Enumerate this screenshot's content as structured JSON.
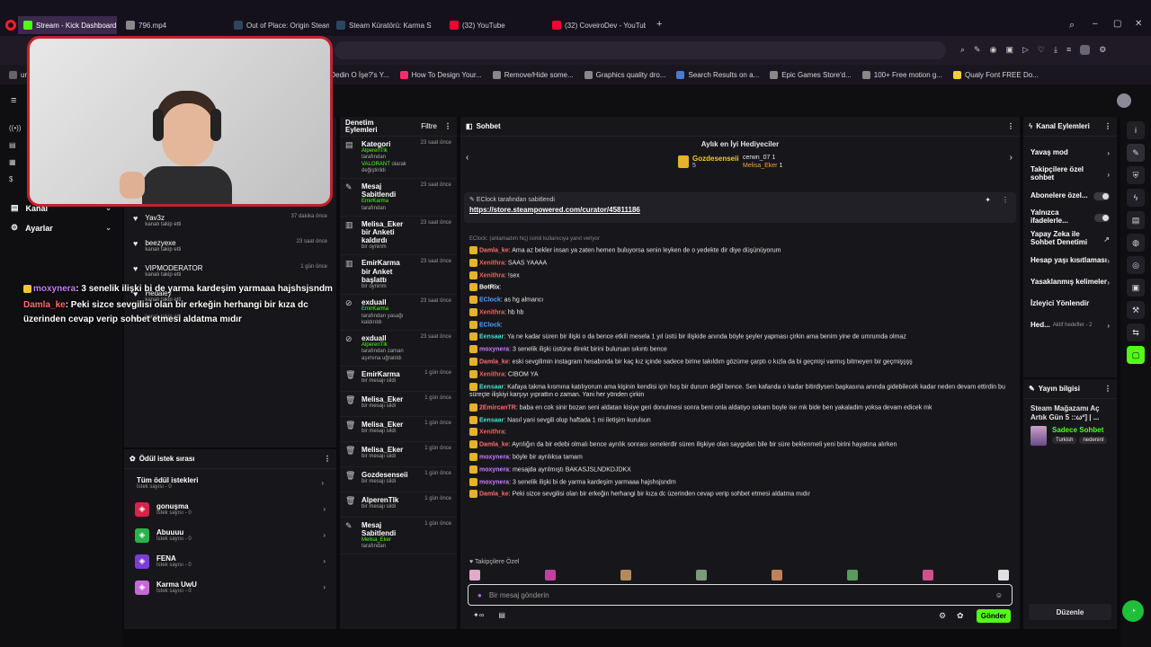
{
  "browser": {
    "tabs": [
      {
        "title": "Stream - Kick Dashboard",
        "color": "#53fc18",
        "active": true
      },
      {
        "title": "796.mp4",
        "color": "#888888"
      },
      {
        "title": "Out of Place: Origin Steam",
        "color": "#2a475e"
      },
      {
        "title": "Steam Küratörü: Karma St",
        "color": "#2a475e"
      },
      {
        "title": "(32) YouTube",
        "color": "#ff0033"
      },
      {
        "title": "(32) CoveiroDev - YouTub",
        "color": "#ff0033"
      }
    ],
    "new_tab": "+",
    "bookmarks": [
      {
        "label": "un",
        "color": "#666666"
      },
      {
        "label": "Ne Dedin O İşe?'s Y...",
        "color": "#777777"
      },
      {
        "label": "How To Design Your...",
        "color": "#ff2b6e"
      },
      {
        "label": "Remove/Hide some...",
        "color": "#888888"
      },
      {
        "label": "Graphics quality dro...",
        "color": "#888888"
      },
      {
        "label": "Search Results on a...",
        "color": "#4a7bd1"
      },
      {
        "label": "Epic Games Store'd...",
        "color": "#888888"
      },
      {
        "label": "100+ Free motion g...",
        "color": "#888888"
      },
      {
        "label": "Qualy Font FREE Do...",
        "color": "#f2d02f"
      }
    ]
  },
  "sidebar": {
    "items": [
      {
        "label": "Kanal"
      },
      {
        "label": "Ayarlar"
      }
    ]
  },
  "followers": [
    {
      "name": "Yav3z",
      "sub": "kanalı takip etti",
      "time": "37 dakika önce"
    },
    {
      "name": "beezyexe",
      "sub": "kanalı takip etti",
      "time": "23 saat önce"
    },
    {
      "name": "VIPMODERATOR",
      "sub": "kanalı takip etti",
      "time": "1 gün önce"
    },
    {
      "name": "Hedaley",
      "sub": "kanalı takip etti",
      "time": ""
    },
    {
      "name": "",
      "sub": "kanalı takip etti",
      "time": ""
    }
  ],
  "overlay": [
    {
      "user": "moxynera",
      "text": ": 3 senelik ilişki bi de yarma kardeşim yarmaaa hajshsjsndm",
      "ucolor": "#c87cff"
    },
    {
      "user": "Damla_ke",
      "text": ": Peki sizce sevgilisi olan bir erkeğin herhangi bir kıza dc",
      "ucolor": "#ff6b6b"
    },
    {
      "user": "",
      "text": "üzerinden cevap verip sohbet etmesi aldatma mıdır",
      "ucolor": "#ffffff"
    }
  ],
  "rewards": {
    "title": "Ödül istek sırası",
    "all": "Tüm ödül istekleri",
    "all_count": "İstek sayısı - 0",
    "items": [
      {
        "name": "gonuşma",
        "count": "İstek sayısı - 0",
        "color": "#d6244a"
      },
      {
        "name": "Abuuuu",
        "count": "İstek sayısı - 0",
        "color": "#2bb24c"
      },
      {
        "name": "FENA",
        "count": "İstek sayısı - 0",
        "color": "#7a3fd1"
      },
      {
        "name": "Karma UwU",
        "count": "İstek sayısı - 0",
        "color": "#c46ad8"
      }
    ]
  },
  "mod": {
    "title": "Denetim Eylemleri",
    "filter": "Filtre",
    "actions": [
      {
        "icon": "▤",
        "title": "Kategori",
        "line1": "AlperenTlk",
        "line1b": " tarafından",
        "line2": "VALORANT",
        "line2b": " olarak değiştirildi",
        "time": "23 saat önce"
      },
      {
        "icon": "✎",
        "title": "Mesaj Sabitlendi",
        "line1": "EmirKarma",
        "line1b": " tarafından",
        "line2": "",
        "line2b": "",
        "time": "23 saat önce"
      },
      {
        "icon": "▥",
        "title": "Melisa_Eker bir Anketi kaldırdı",
        "line1": "",
        "line1b": "bir oyninm",
        "line2": "",
        "line2b": "",
        "time": "23 saat önce"
      },
      {
        "icon": "▥",
        "title": "EmirKarma bir Anket başlattı",
        "line1": "",
        "line1b": "bir oyninm",
        "line2": "",
        "line2b": "",
        "time": "23 saat önce"
      },
      {
        "icon": "⊘",
        "title": "exduall",
        "line1": "EmirKarma",
        "line1b": " tarafından yasağı kaldırıldı",
        "line2": "",
        "line2b": "",
        "time": "23 saat önce"
      },
      {
        "icon": "⊘",
        "title": "exduall",
        "line1": "AlperenTlk",
        "line1b": " tarafından zaman aşımına uğratıldı",
        "line2": "",
        "line2b": "",
        "time": "23 saat önce"
      },
      {
        "icon": "🗑",
        "title": "EmirKarma",
        "line1": "",
        "line1b": "bir mesajı sildi",
        "line2": "",
        "line2b": "",
        "time": "1 gün önce"
      },
      {
        "icon": "🗑",
        "title": "Melisa_Eker",
        "line1": "",
        "line1b": "bir mesajı sildi",
        "line2": "",
        "line2b": "",
        "time": "1 gün önce"
      },
      {
        "icon": "🗑",
        "title": "Melisa_Eker",
        "line1": "",
        "line1b": "bir mesajı sildi",
        "line2": "",
        "line2b": "",
        "time": "1 gün önce"
      },
      {
        "icon": "🗑",
        "title": "Melisa_Eker",
        "line1": "",
        "line1b": "bir mesajı sildi",
        "line2": "",
        "line2b": "",
        "time": "1 gün önce"
      },
      {
        "icon": "🗑",
        "title": "Gozdesenseii",
        "line1": "",
        "line1b": "bir mesajı sildi",
        "line2": "",
        "line2b": "",
        "time": "1 gün önce"
      },
      {
        "icon": "🗑",
        "title": "AlperenTlk",
        "line1": "",
        "line1b": "bir mesajı sildi",
        "line2": "",
        "line2b": "",
        "time": "1 gün önce"
      },
      {
        "icon": "✎",
        "title": "Mesaj Sabitlendi",
        "line1": "Melisa_Eker",
        "line1b": " tarafından",
        "line2": "",
        "line2b": "",
        "time": "1 gün önce"
      }
    ]
  },
  "chat": {
    "title": "Sohbet",
    "gifters_title": "Aylık en İyi Hediyeciler",
    "gifters": [
      {
        "name": "Gozdesenseii",
        "count": "5"
      },
      {
        "name": "cerwn_07",
        "count": "1"
      },
      {
        "name": "Melisa_Eker",
        "count": "1"
      }
    ],
    "pinned_by": "EClock tarafından sabitlendi",
    "pinned_link": "https://store.steampowered.com/curator/45811186",
    "reply_hint": "EClock: (anlamadım hiç) isimli kullanıcıya yanıt veriyor",
    "messages": [
      {
        "user": "Damla_ke",
        "text": ": Ama az bekler insan ya zaten hemen buluyorsa senin leyken de o yedekte dir diye düşünüyorum",
        "color": "#ff6b6b"
      },
      {
        "user": "Xenithra",
        "text": ": SAAS YAAAA",
        "color": "#ff5a5a"
      },
      {
        "user": "Xenithra",
        "text": ": !sex",
        "color": "#ff5a5a"
      },
      {
        "user": "BotRix",
        "text": ":",
        "color": "#ffffff"
      },
      {
        "user": "EClock",
        "text": ": as hg almancı",
        "color": "#4aa3ff"
      },
      {
        "user": "Xenithra",
        "text": ": hb hb",
        "color": "#ff5a5a"
      },
      {
        "user": "EClock",
        "text": ":",
        "color": "#4aa3ff"
      },
      {
        "user": "Eensaar",
        "text": ": Ya ne kadar süren bir ilişki o da bence etkili mesela 1 yıl üstü bir ilişkide anında böyle şeyler yapması çirkin ama benim yine de umrumda olmaz",
        "color": "#4ee0d0"
      },
      {
        "user": "moxynera",
        "text": ": 3 senelik ilişki üstüne direkt birini bulursan sıkıntı bence",
        "color": "#c87cff"
      },
      {
        "user": "Damla_ke",
        "text": ": eski sevgilimin instagram hesabında bir kaç kız içinde sadece birine takıldım gözüme çarptı o kızla da bi geçmişi varmış bitmeyen bir geçmişşşş",
        "color": "#ff6b6b"
      },
      {
        "user": "Xenithra",
        "text": ": CIBOM YA",
        "color": "#ff5a5a"
      },
      {
        "user": "Eensaar",
        "text": ": Kafaya takma kısmına katılıyorum ama kişinin kendisi için hoş bir durum değil bence. Sen kafanda o kadar bitirdiysen başkasına anında gidebilecek kadar neden devam ettirdin bu süreçte ilişkiyi karşıyı yıprattın o zaman. Yani her yönden çirkin",
        "color": "#4ee0d0"
      },
      {
        "user": "2EmircanTR",
        "text": ": baba en cok sinir bozan seni aldatan kisiye geri donulmesi sonra beni onla aldatiyo sokam boyle ise mk bide ben yakaladim yoksa devam edicek mk",
        "color": "#ff6b6b"
      },
      {
        "user": "Eensaar",
        "text": ": Nasıl yani sevgili olup haftada 1 mi iletişim kurulsun",
        "color": "#4ee0d0"
      },
      {
        "user": "Xenithra",
        "text": ":",
        "color": "#ff5a5a"
      },
      {
        "user": "Damla_ke",
        "text": ": Ayrılığın da bir edebi olmalı bence ayrılık sonrası senelerdir süren ilişkiye olan saygıdan bile bir süre beklenmeli yeni birini hayatına alırken",
        "color": "#ff6b6b"
      },
      {
        "user": "moxynera",
        "text": ": böyle bir ayrılıksa tamam",
        "color": "#c87cff"
      },
      {
        "user": "moxynera",
        "text": ": mesajda ayrılmıştı BAKASJSLNDKDJDKX",
        "color": "#c87cff"
      },
      {
        "user": "moxynera",
        "text": ": 3 senelik ilişki bi de yarma kardeşim yarmaaa hajshsjsndm",
        "color": "#c87cff"
      },
      {
        "user": "Damla_ke",
        "text": ": Peki sizce sevgilisi olan bir erkeğin herhangi bir kıza dc üzerinden cevap verip sohbet etmesi aldatma mıdır",
        "color": "#ff6b6b"
      }
    ],
    "followers_only": "Takipçilere Özel",
    "input_placeholder": "Bir mesaj gönderin",
    "send": "Gönder"
  },
  "actions": {
    "title": "Kanal Eylemleri",
    "items": [
      {
        "label": "Yavaş mod",
        "kind": "chev"
      },
      {
        "label": "Takipçilere özel sohbet",
        "kind": "chev"
      },
      {
        "label": "Abonelere özel...",
        "kind": "toggle"
      },
      {
        "label": "Yalnızca ifadelerle...",
        "kind": "toggle"
      },
      {
        "label": "Yapay Zeka ile Sohbet Denetimi",
        "kind": "ext"
      },
      {
        "label": "Hesap yaşı kısıtlaması",
        "kind": "chev"
      },
      {
        "label": "Yasaklanmış kelimeler",
        "kind": "chev"
      },
      {
        "label": "İzleyici Yönlendir",
        "kind": "none"
      },
      {
        "label": "Hed...",
        "kind": "chev",
        "extra": "Aktif hedefler - 2"
      }
    ]
  },
  "stream_info": {
    "title": "Yayın bilgisi",
    "stream_title": "Steam Mağazamı Aç Artık Gün 5 ::ωº] | ...",
    "category": "Sadece Sohbet",
    "tags": [
      "Turkish",
      "nedeninl"
    ],
    "edit": "Düzenle"
  }
}
